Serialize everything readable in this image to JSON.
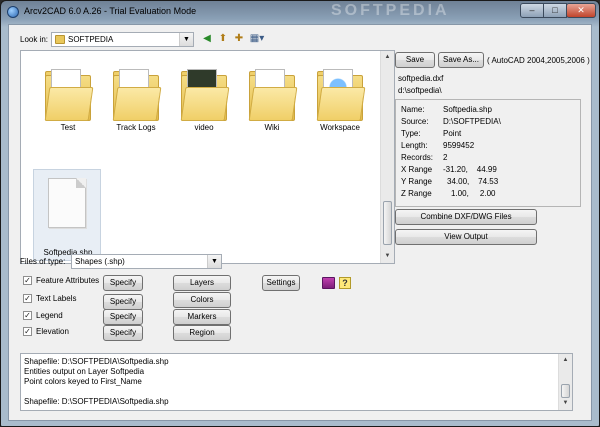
{
  "window": {
    "title": "Arcv2CAD 6.0 A.26 - Trial Evaluation Mode",
    "watermark": "SOFTPEDIA",
    "controls": {
      "minimize": "–",
      "maximize": "□",
      "close": "✕"
    }
  },
  "look_in": {
    "label": "Look in:",
    "value": "SOFTPEDIA"
  },
  "toolbar": {
    "back_icon": "back-arrow-icon",
    "up_icon": "up-folder-icon",
    "new_folder_icon": "new-folder-icon",
    "view_icon": "view-menu-icon"
  },
  "files": [
    {
      "name": "Test",
      "type": "folder"
    },
    {
      "name": "Track Logs",
      "type": "folder"
    },
    {
      "name": "video",
      "type": "folder"
    },
    {
      "name": "Wiki",
      "type": "folder"
    },
    {
      "name": "Workspace",
      "type": "folder"
    },
    {
      "name": "Softpedia.shp",
      "type": "file",
      "selected": true
    }
  ],
  "right_panel": {
    "save": "Save",
    "save_as": "Save As...",
    "format": "( AutoCAD 2004,2005,2006 )",
    "output_file": "softpedia.dxf",
    "output_dir": "d:\\softpedia\\",
    "info": [
      {
        "k": "Name:",
        "v": "Softpedia.shp"
      },
      {
        "k": "Source:",
        "v": "D:\\SOFTPEDIA\\"
      },
      {
        "k": "Type:",
        "v": "Point"
      },
      {
        "k": "Length:",
        "v": "9599452"
      },
      {
        "k": "Records:",
        "v": "2"
      },
      {
        "k": "X Range",
        "v": "-31.20,    44.99"
      },
      {
        "k": "Y Range",
        "v": "34.00,    74.53"
      },
      {
        "k": "Z Range",
        "v": "1.00,     2.00"
      }
    ],
    "combine": "Combine DXF/DWG Files",
    "view_output": "View Output"
  },
  "files_of_type": {
    "label": "Files of type:",
    "value": "Shapes (.shp)"
  },
  "options": [
    {
      "label": "Feature Attributes",
      "checked": true,
      "button": "Specify"
    },
    {
      "label": "Text Labels",
      "checked": true,
      "button": "Specify"
    },
    {
      "label": "Legend",
      "checked": true,
      "button": "Specify"
    },
    {
      "label": "Elevation",
      "checked": true,
      "button": "Specify"
    }
  ],
  "middle_buttons": [
    "Layers",
    "Colors",
    "Markers",
    "Region"
  ],
  "settings": "Settings",
  "log": [
    "Shapefile: D:\\SOFTPEDIA\\Softpedia.shp",
    "Entities output on Layer Softpedia",
    "Point colors keyed to First_Name",
    "",
    "Shapefile: D:\\SOFTPEDIA\\Softpedia.shp"
  ]
}
